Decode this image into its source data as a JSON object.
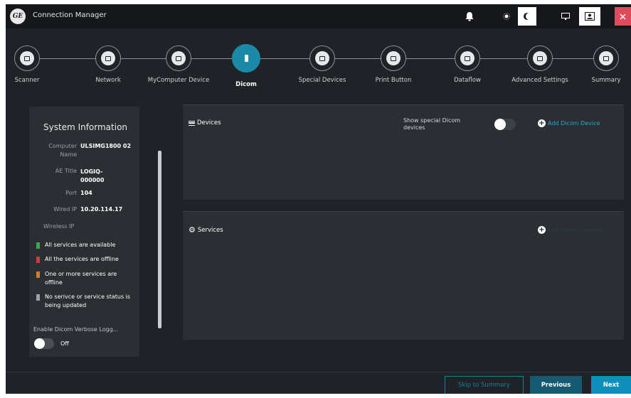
{
  "window": {
    "logo": "GE",
    "title": "Connection Manager",
    "icons": [
      "bell-icon",
      "sun-icon",
      "moon-icon",
      "monitor-icon",
      "user-icon",
      "close-icon"
    ]
  },
  "steps": [
    {
      "label": "Scanner",
      "icon": "monitor-icon"
    },
    {
      "label": "Network",
      "icon": "network-icon"
    },
    {
      "label": "MyComputer Device",
      "icon": "laptop-icon"
    },
    {
      "label": "Dicom",
      "icon": "document-icon",
      "active": true
    },
    {
      "label": "Special Devices",
      "icon": "tools-icon"
    },
    {
      "label": "Print Button",
      "icon": "printer-icon"
    },
    {
      "label": "Dataflow",
      "icon": "dataflow-icon"
    },
    {
      "label": "Advanced Settings",
      "icon": "list-icon"
    },
    {
      "label": "Summary",
      "icon": "summary-icon"
    }
  ],
  "system_info": {
    "title": "System Information",
    "computer_name_label": "Computer Name",
    "computer_name_value": "ULSIMG1800 02",
    "ae_title_label": "AE Title",
    "ae_title_value": "LOGIQ-000000",
    "port_label": "Port",
    "port_value": "104",
    "wired_ip_label": "Wired IP",
    "wired_ip_value": "10.20.114.17",
    "wireless_ip_label": "Wireless IP",
    "legend": [
      {
        "text": "All services are available",
        "color": "#3aa845"
      },
      {
        "text": "All the services are offline",
        "color": "#d23a3a"
      },
      {
        "text": "One or more services are offline",
        "color": "#d07f1e"
      },
      {
        "text": "No serivce or service status is being updated",
        "color": "#9ea3a8"
      }
    ],
    "verbose_label": "Enable Dicom Verbose Logg...",
    "verbose_state": "Off"
  },
  "devices": {
    "title": "Devices",
    "special_label": "Show special Dicom devices",
    "add_label": "Add Dicom Device"
  },
  "services": {
    "title": "Services",
    "add_label": "Add Dicom Service"
  },
  "footer": {
    "skip": "Skip to Summary",
    "previous": "Previous",
    "next": "Next"
  },
  "colors": {
    "accent": "#0f8fbb",
    "background": "#1f2226",
    "panel": "#2b2f33",
    "close": "#e04a5a"
  }
}
